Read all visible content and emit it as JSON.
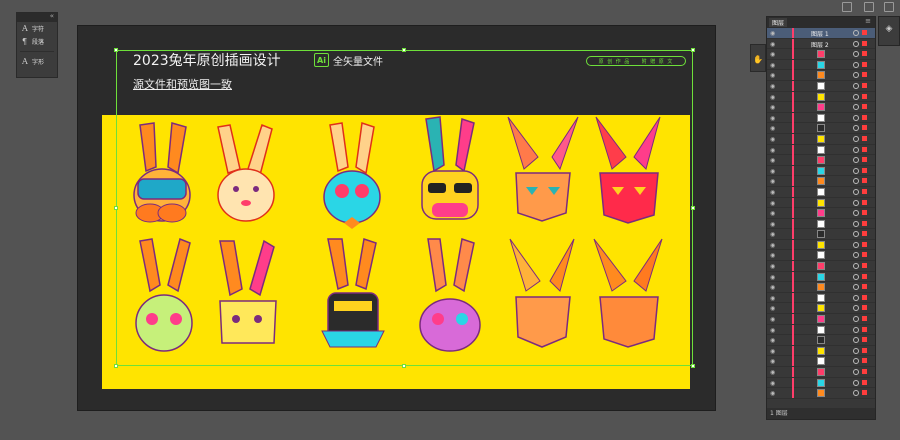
{
  "char_panel": {
    "items": [
      {
        "icon": "A",
        "label": "字符"
      },
      {
        "icon": "¶",
        "label": "段落"
      },
      {
        "icon": "A",
        "label": "字形"
      }
    ],
    "collapse": "«"
  },
  "artboard": {
    "title": "2023兔年原创插画设计",
    "ai_badge": "Ai",
    "ai_text": "全矢量文件",
    "pill": [
      "原 创 作 品",
      "附 赠 原 文"
    ],
    "subtitle": "源文件和预览图一致"
  },
  "layers": {
    "tab_label": "图层",
    "menu": "≡",
    "rows": [
      {
        "name": "图层 1",
        "type": "layer"
      },
      {
        "name": "图层 2",
        "type": "layer"
      }
    ],
    "footer": "1 图层"
  },
  "colors": {
    "accent": "#6ee03a",
    "artboard_bg": "#2b2b2b",
    "yellow": "#ffe400",
    "red_marker": "#ff3d6a"
  }
}
